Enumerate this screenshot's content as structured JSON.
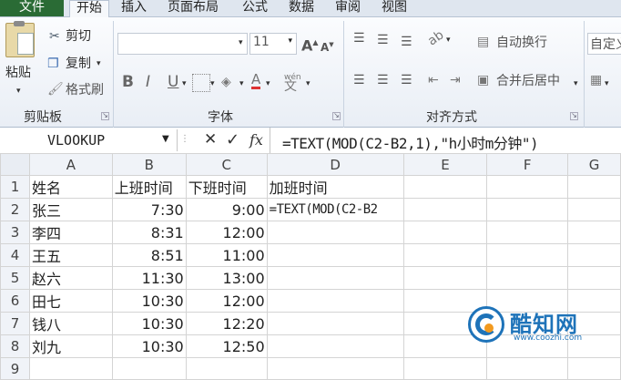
{
  "tabs": {
    "file": "文件",
    "home": "开始",
    "insert": "插入",
    "page_layout": "页面布局",
    "formulas": "公式",
    "data": "数据",
    "review": "审阅",
    "view": "视图"
  },
  "ribbon": {
    "clipboard": {
      "paste": "粘贴",
      "cut": "剪切",
      "copy": "复制",
      "format_painter": "格式刷",
      "group_label": "剪贴板"
    },
    "font": {
      "font_size": "11",
      "bold": "B",
      "italic": "I",
      "underline": "U",
      "grow": "A",
      "shrink": "A",
      "font_color": "A",
      "phonetic": "wén",
      "group_label": "字体"
    },
    "alignment": {
      "wrap_text": "自动换行",
      "merge_center": "合并后居中",
      "group_label": "对齐方式"
    },
    "number": {
      "format": "自定义"
    }
  },
  "formula_bar": {
    "name_box": "VLOOKUP",
    "cancel": "✕",
    "enter": "✓",
    "fx": "fx",
    "formula": "=TEXT(MOD(C2-B2,1),\"h小时m分钟\")"
  },
  "sheet": {
    "columns": [
      "A",
      "B",
      "C",
      "D",
      "E",
      "F",
      "G"
    ],
    "rows": [
      {
        "n": "1",
        "a": "姓名",
        "b": "上班时间",
        "c": "下班时间",
        "d": "加班时间"
      },
      {
        "n": "2",
        "a": "张三",
        "b": "7:30",
        "c": "9:00",
        "d": "=TEXT(MOD(C2-B2"
      },
      {
        "n": "3",
        "a": "李四",
        "b": "8:31",
        "c": "12:00",
        "d": ""
      },
      {
        "n": "4",
        "a": "王五",
        "b": "8:51",
        "c": "11:00",
        "d": ""
      },
      {
        "n": "5",
        "a": "赵六",
        "b": "11:30",
        "c": "13:00",
        "d": ""
      },
      {
        "n": "6",
        "a": "田七",
        "b": "10:30",
        "c": "12:00",
        "d": ""
      },
      {
        "n": "7",
        "a": "钱八",
        "b": "10:30",
        "c": "12:20",
        "d": ""
      },
      {
        "n": "8",
        "a": "刘九",
        "b": "10:30",
        "c": "12:50",
        "d": ""
      },
      {
        "n": "9",
        "a": "",
        "b": "",
        "c": "",
        "d": ""
      }
    ]
  },
  "watermark": {
    "brand": "酷知网",
    "url": "www.coozhi.com"
  },
  "colors": {
    "file_tab": "#2a6b35",
    "watermark_blue": "#1e73b9",
    "watermark_orange": "#f29a1f"
  }
}
